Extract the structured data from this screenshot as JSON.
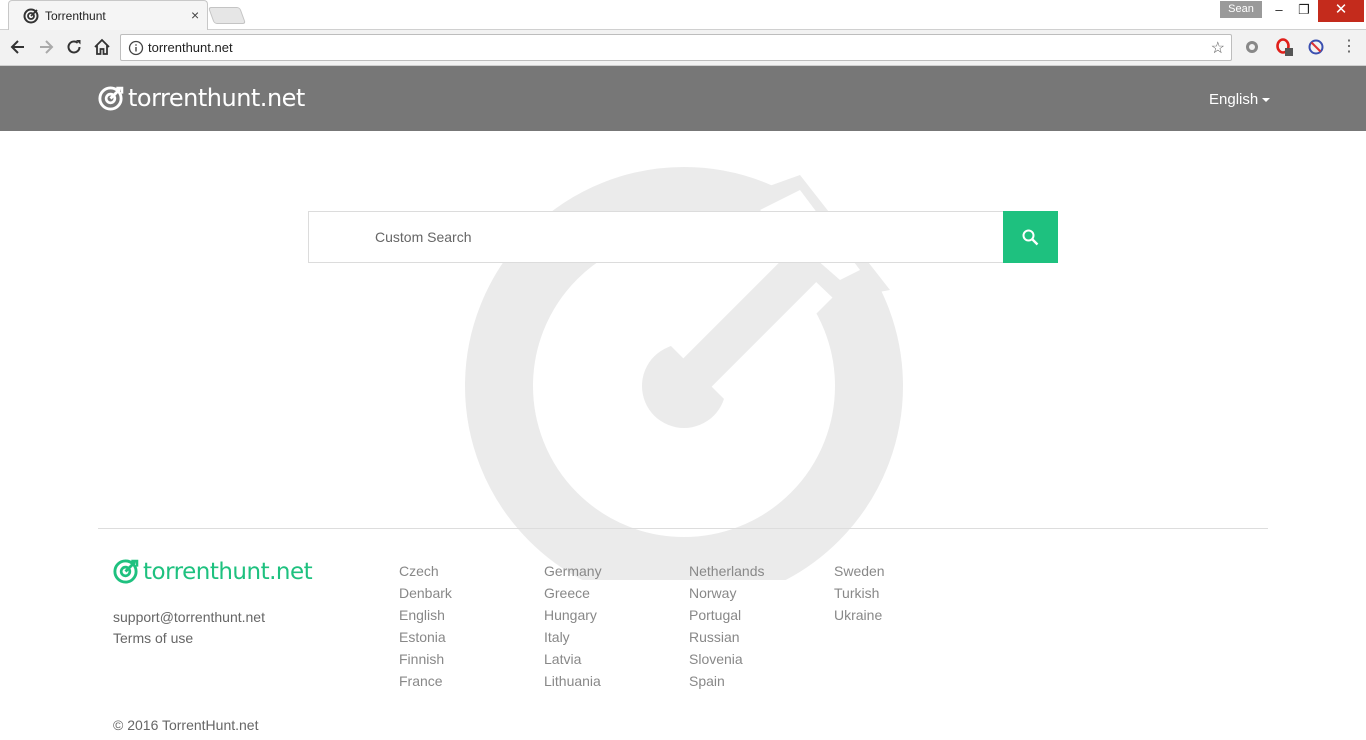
{
  "browser": {
    "tab_title": "Torrenthunt",
    "tab_close": "×",
    "profile_name": "Sean",
    "url": "torrenthunt.net",
    "win_min": "–",
    "win_max": "❐",
    "win_close": "✕"
  },
  "header": {
    "logo_text": "torrenthunt.net",
    "language": "English"
  },
  "search": {
    "placeholder": "Custom Search"
  },
  "footer": {
    "logo_text": "torrenthunt.net",
    "email": "support@torrenthunt.net",
    "terms": "Terms of use",
    "copyright": "© 2016 TorrentHunt.net",
    "languages": {
      "col1": [
        "Czech",
        "Denbark",
        "English",
        "Estonia",
        "Finnish",
        "France"
      ],
      "col2": [
        "Germany",
        "Greece",
        "Hungary",
        "Italy",
        "Latvia",
        "Lithuania"
      ],
      "col3": [
        "Netherlands",
        "Norway",
        "Portugal",
        "Russian",
        "Slovenia",
        "Spain"
      ],
      "col4": [
        "Sweden",
        "Turkish",
        "Ukraine"
      ]
    }
  },
  "colors": {
    "header_bg": "#777777",
    "accent": "#1ec17f",
    "watermark": "#ebebeb"
  }
}
